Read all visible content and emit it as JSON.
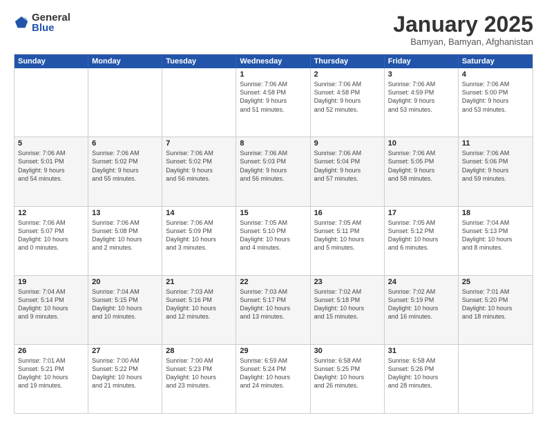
{
  "logo": {
    "general": "General",
    "blue": "Blue"
  },
  "title": "January 2025",
  "location": "Bamyan, Bamyan, Afghanistan",
  "weekdays": [
    "Sunday",
    "Monday",
    "Tuesday",
    "Wednesday",
    "Thursday",
    "Friday",
    "Saturday"
  ],
  "rows": [
    {
      "alt": false,
      "cells": [
        {
          "empty": true
        },
        {
          "empty": true
        },
        {
          "empty": true
        },
        {
          "num": "1",
          "lines": [
            "Sunrise: 7:06 AM",
            "Sunset: 4:58 PM",
            "Daylight: 9 hours",
            "and 51 minutes."
          ]
        },
        {
          "num": "2",
          "lines": [
            "Sunrise: 7:06 AM",
            "Sunset: 4:58 PM",
            "Daylight: 9 hours",
            "and 52 minutes."
          ]
        },
        {
          "num": "3",
          "lines": [
            "Sunrise: 7:06 AM",
            "Sunset: 4:59 PM",
            "Daylight: 9 hours",
            "and 53 minutes."
          ]
        },
        {
          "num": "4",
          "lines": [
            "Sunrise: 7:06 AM",
            "Sunset: 5:00 PM",
            "Daylight: 9 hours",
            "and 53 minutes."
          ]
        }
      ]
    },
    {
      "alt": true,
      "cells": [
        {
          "num": "5",
          "lines": [
            "Sunrise: 7:06 AM",
            "Sunset: 5:01 PM",
            "Daylight: 9 hours",
            "and 54 minutes."
          ]
        },
        {
          "num": "6",
          "lines": [
            "Sunrise: 7:06 AM",
            "Sunset: 5:02 PM",
            "Daylight: 9 hours",
            "and 55 minutes."
          ]
        },
        {
          "num": "7",
          "lines": [
            "Sunrise: 7:06 AM",
            "Sunset: 5:02 PM",
            "Daylight: 9 hours",
            "and 56 minutes."
          ]
        },
        {
          "num": "8",
          "lines": [
            "Sunrise: 7:06 AM",
            "Sunset: 5:03 PM",
            "Daylight: 9 hours",
            "and 56 minutes."
          ]
        },
        {
          "num": "9",
          "lines": [
            "Sunrise: 7:06 AM",
            "Sunset: 5:04 PM",
            "Daylight: 9 hours",
            "and 57 minutes."
          ]
        },
        {
          "num": "10",
          "lines": [
            "Sunrise: 7:06 AM",
            "Sunset: 5:05 PM",
            "Daylight: 9 hours",
            "and 58 minutes."
          ]
        },
        {
          "num": "11",
          "lines": [
            "Sunrise: 7:06 AM",
            "Sunset: 5:06 PM",
            "Daylight: 9 hours",
            "and 59 minutes."
          ]
        }
      ]
    },
    {
      "alt": false,
      "cells": [
        {
          "num": "12",
          "lines": [
            "Sunrise: 7:06 AM",
            "Sunset: 5:07 PM",
            "Daylight: 10 hours",
            "and 0 minutes."
          ]
        },
        {
          "num": "13",
          "lines": [
            "Sunrise: 7:06 AM",
            "Sunset: 5:08 PM",
            "Daylight: 10 hours",
            "and 2 minutes."
          ]
        },
        {
          "num": "14",
          "lines": [
            "Sunrise: 7:06 AM",
            "Sunset: 5:09 PM",
            "Daylight: 10 hours",
            "and 3 minutes."
          ]
        },
        {
          "num": "15",
          "lines": [
            "Sunrise: 7:05 AM",
            "Sunset: 5:10 PM",
            "Daylight: 10 hours",
            "and 4 minutes."
          ]
        },
        {
          "num": "16",
          "lines": [
            "Sunrise: 7:05 AM",
            "Sunset: 5:11 PM",
            "Daylight: 10 hours",
            "and 5 minutes."
          ]
        },
        {
          "num": "17",
          "lines": [
            "Sunrise: 7:05 AM",
            "Sunset: 5:12 PM",
            "Daylight: 10 hours",
            "and 6 minutes."
          ]
        },
        {
          "num": "18",
          "lines": [
            "Sunrise: 7:04 AM",
            "Sunset: 5:13 PM",
            "Daylight: 10 hours",
            "and 8 minutes."
          ]
        }
      ]
    },
    {
      "alt": true,
      "cells": [
        {
          "num": "19",
          "lines": [
            "Sunrise: 7:04 AM",
            "Sunset: 5:14 PM",
            "Daylight: 10 hours",
            "and 9 minutes."
          ]
        },
        {
          "num": "20",
          "lines": [
            "Sunrise: 7:04 AM",
            "Sunset: 5:15 PM",
            "Daylight: 10 hours",
            "and 10 minutes."
          ]
        },
        {
          "num": "21",
          "lines": [
            "Sunrise: 7:03 AM",
            "Sunset: 5:16 PM",
            "Daylight: 10 hours",
            "and 12 minutes."
          ]
        },
        {
          "num": "22",
          "lines": [
            "Sunrise: 7:03 AM",
            "Sunset: 5:17 PM",
            "Daylight: 10 hours",
            "and 13 minutes."
          ]
        },
        {
          "num": "23",
          "lines": [
            "Sunrise: 7:02 AM",
            "Sunset: 5:18 PM",
            "Daylight: 10 hours",
            "and 15 minutes."
          ]
        },
        {
          "num": "24",
          "lines": [
            "Sunrise: 7:02 AM",
            "Sunset: 5:19 PM",
            "Daylight: 10 hours",
            "and 16 minutes."
          ]
        },
        {
          "num": "25",
          "lines": [
            "Sunrise: 7:01 AM",
            "Sunset: 5:20 PM",
            "Daylight: 10 hours",
            "and 18 minutes."
          ]
        }
      ]
    },
    {
      "alt": false,
      "cells": [
        {
          "num": "26",
          "lines": [
            "Sunrise: 7:01 AM",
            "Sunset: 5:21 PM",
            "Daylight: 10 hours",
            "and 19 minutes."
          ]
        },
        {
          "num": "27",
          "lines": [
            "Sunrise: 7:00 AM",
            "Sunset: 5:22 PM",
            "Daylight: 10 hours",
            "and 21 minutes."
          ]
        },
        {
          "num": "28",
          "lines": [
            "Sunrise: 7:00 AM",
            "Sunset: 5:23 PM",
            "Daylight: 10 hours",
            "and 23 minutes."
          ]
        },
        {
          "num": "29",
          "lines": [
            "Sunrise: 6:59 AM",
            "Sunset: 5:24 PM",
            "Daylight: 10 hours",
            "and 24 minutes."
          ]
        },
        {
          "num": "30",
          "lines": [
            "Sunrise: 6:58 AM",
            "Sunset: 5:25 PM",
            "Daylight: 10 hours",
            "and 26 minutes."
          ]
        },
        {
          "num": "31",
          "lines": [
            "Sunrise: 6:58 AM",
            "Sunset: 5:26 PM",
            "Daylight: 10 hours",
            "and 28 minutes."
          ]
        },
        {
          "empty": true
        }
      ]
    }
  ]
}
